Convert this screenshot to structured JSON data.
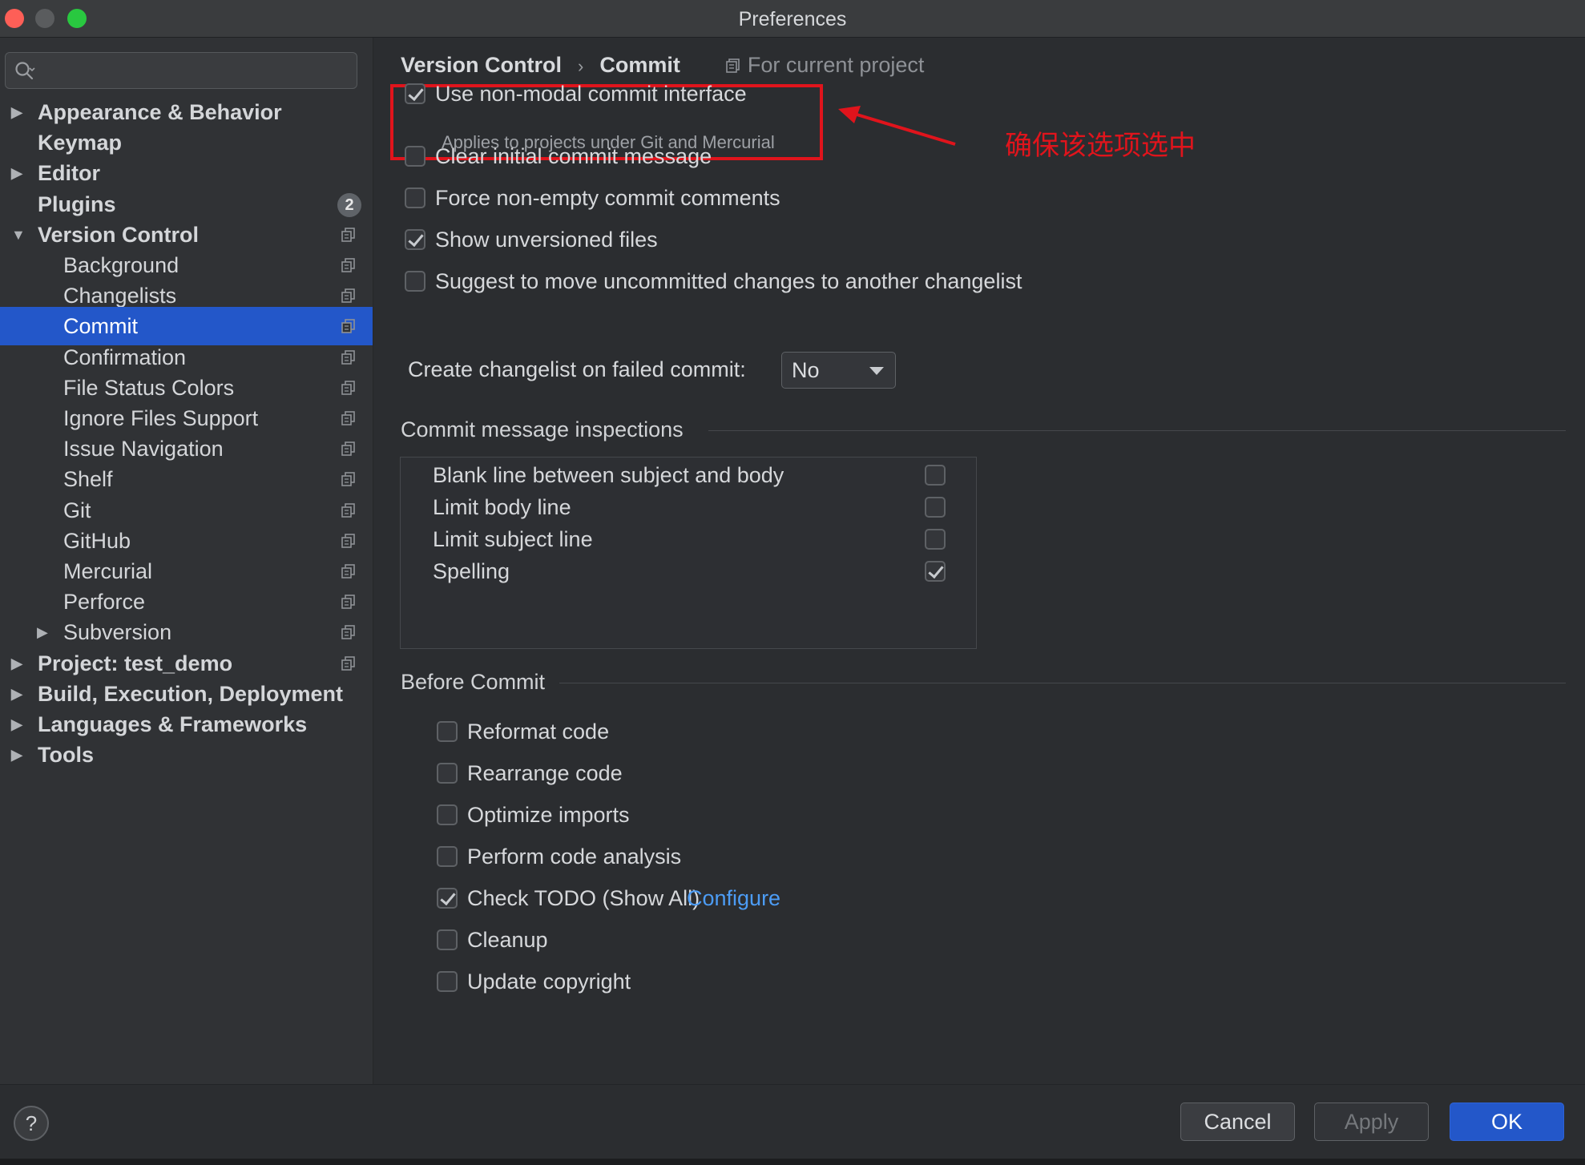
{
  "window": {
    "title": "Preferences"
  },
  "search": {
    "placeholder": ""
  },
  "sidebar": {
    "items": [
      {
        "label": "Appearance & Behavior",
        "bold": true,
        "level": 0,
        "expandable": true,
        "expanded": false
      },
      {
        "label": "Keymap",
        "bold": true,
        "level": 0
      },
      {
        "label": "Editor",
        "bold": true,
        "level": 0,
        "expandable": true,
        "expanded": false
      },
      {
        "label": "Plugins",
        "bold": true,
        "level": 0,
        "badge": "2"
      },
      {
        "label": "Version Control",
        "bold": true,
        "level": 0,
        "expandable": true,
        "expanded": true,
        "project_icon": true
      },
      {
        "label": "Background",
        "level": 1,
        "project_icon": true
      },
      {
        "label": "Changelists",
        "level": 1,
        "project_icon": true
      },
      {
        "label": "Commit",
        "level": 1,
        "project_icon": true,
        "selected": true
      },
      {
        "label": "Confirmation",
        "level": 1,
        "project_icon": true
      },
      {
        "label": "File Status Colors",
        "level": 1,
        "project_icon": true
      },
      {
        "label": "Ignore Files Support",
        "level": 1,
        "project_icon": true
      },
      {
        "label": "Issue Navigation",
        "level": 1,
        "project_icon": true
      },
      {
        "label": "Shelf",
        "level": 1,
        "project_icon": true
      },
      {
        "label": "Git",
        "level": 1,
        "project_icon": true
      },
      {
        "label": "GitHub",
        "level": 1,
        "project_icon": true
      },
      {
        "label": "Mercurial",
        "level": 1,
        "project_icon": true
      },
      {
        "label": "Perforce",
        "level": 1,
        "project_icon": true
      },
      {
        "label": "Subversion",
        "level": 1,
        "expandable": true,
        "expanded": false,
        "project_icon": true
      },
      {
        "label": "Project: test_demo",
        "bold": true,
        "level": 0,
        "expandable": true,
        "expanded": false,
        "project_icon": true
      },
      {
        "label": "Build, Execution, Deployment",
        "bold": true,
        "level": 0,
        "expandable": true,
        "expanded": false
      },
      {
        "label": "Languages & Frameworks",
        "bold": true,
        "level": 0,
        "expandable": true,
        "expanded": false
      },
      {
        "label": "Tools",
        "bold": true,
        "level": 0,
        "expandable": true,
        "expanded": false
      }
    ]
  },
  "breadcrumb": {
    "section": "Version Control",
    "separator": "›",
    "page": "Commit",
    "scope": "For current project"
  },
  "options": {
    "non_modal": {
      "label": "Use non-modal commit interface",
      "note": "Applies to projects under Git and Mercurial",
      "checked": true
    },
    "list": [
      {
        "label": "Clear initial commit message",
        "checked": false
      },
      {
        "label": "Force non-empty commit comments",
        "checked": false
      },
      {
        "label": "Show unversioned files",
        "checked": true
      },
      {
        "label": "Suggest to move uncommitted changes to another changelist",
        "checked": false
      }
    ],
    "changelist_dropdown": {
      "label": "Create changelist on failed commit:",
      "value": "No"
    }
  },
  "annotation": {
    "text": "确保该选项选中",
    "color": "#e0141c"
  },
  "inspections": {
    "title": "Commit message inspections",
    "items": [
      {
        "label": "Blank line between subject and body",
        "checked": false
      },
      {
        "label": "Limit body line",
        "checked": false
      },
      {
        "label": "Limit subject line",
        "checked": false
      },
      {
        "label": "Spelling",
        "checked": true
      }
    ]
  },
  "before_commit": {
    "title": "Before Commit",
    "items": [
      {
        "label": "Reformat code",
        "checked": false
      },
      {
        "label": "Rearrange code",
        "checked": false
      },
      {
        "label": "Optimize imports",
        "checked": false
      },
      {
        "label": "Perform code analysis",
        "checked": false
      },
      {
        "label": "Check TODO (Show All)",
        "checked": true,
        "link": "Configure"
      },
      {
        "label": "Cleanup",
        "checked": false
      },
      {
        "label": "Update copyright",
        "checked": false
      }
    ]
  },
  "footer": {
    "help": "?",
    "cancel": "Cancel",
    "apply": "Apply",
    "ok": "OK"
  },
  "colors": {
    "accent": "#2357c9",
    "link": "#4c9cf5",
    "highlight": "#e0141c"
  }
}
